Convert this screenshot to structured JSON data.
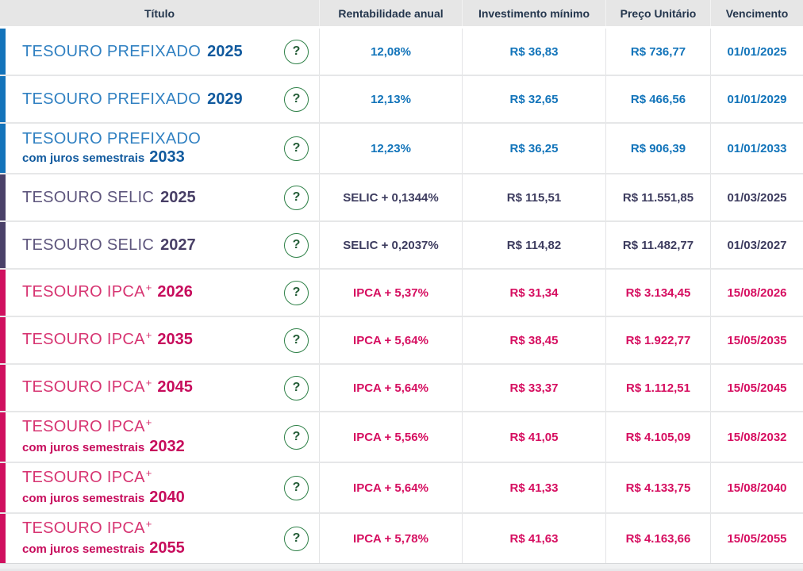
{
  "table": {
    "columns": [
      {
        "key": "titulo",
        "label": "Título"
      },
      {
        "key": "rentabilidade",
        "label": "Rentabilidade anual"
      },
      {
        "key": "investimento",
        "label": "Investimento mínimo"
      },
      {
        "key": "preco",
        "label": "Preço Unitário"
      },
      {
        "key": "vencimento",
        "label": "Vencimento"
      }
    ],
    "help_icon": "?",
    "help_icon_border_color": "#2f8148",
    "families": {
      "prefixado": {
        "bar": "#1373ba",
        "name_color": "#3181c2",
        "strong_color": "#115a9e",
        "value_color": "#1274ba"
      },
      "selic": {
        "bar": "#4a4169",
        "name_color": "#5e567d",
        "strong_color": "#483f66",
        "value_color": "#3d3c5f"
      },
      "ipca": {
        "bar": "#d0105f",
        "name_color": "#d73572",
        "strong_color": "#c70c5c",
        "value_color": "#d60e60"
      }
    },
    "rows": [
      {
        "family": "prefixado",
        "name": "TESOURO PREFIXADO",
        "sup": "",
        "sub": "",
        "year": "2025",
        "rentabilidade": "12,08%",
        "investimento": "R$ 36,83",
        "preco": "R$ 736,77",
        "vencimento": "01/01/2025"
      },
      {
        "family": "prefixado",
        "name": "TESOURO PREFIXADO",
        "sup": "",
        "sub": "",
        "year": "2029",
        "rentabilidade": "12,13%",
        "investimento": "R$ 32,65",
        "preco": "R$ 466,56",
        "vencimento": "01/01/2029"
      },
      {
        "family": "prefixado",
        "name": "TESOURO PREFIXADO",
        "sup": "",
        "sub": "com juros semestrais",
        "year": "2033",
        "rentabilidade": "12,23%",
        "investimento": "R$ 36,25",
        "preco": "R$ 906,39",
        "vencimento": "01/01/2033"
      },
      {
        "family": "selic",
        "name": "TESOURO SELIC",
        "sup": "",
        "sub": "",
        "year": "2025",
        "rentabilidade": "SELIC + 0,1344%",
        "investimento": "R$ 115,51",
        "preco": "R$ 11.551,85",
        "vencimento": "01/03/2025"
      },
      {
        "family": "selic",
        "name": "TESOURO SELIC",
        "sup": "",
        "sub": "",
        "year": "2027",
        "rentabilidade": "SELIC + 0,2037%",
        "investimento": "R$ 114,82",
        "preco": "R$ 11.482,77",
        "vencimento": "01/03/2027"
      },
      {
        "family": "ipca",
        "name": "TESOURO IPCA",
        "sup": "+",
        "sub": "",
        "year": "2026",
        "rentabilidade": "IPCA + 5,37%",
        "investimento": "R$ 31,34",
        "preco": "R$ 3.134,45",
        "vencimento": "15/08/2026"
      },
      {
        "family": "ipca",
        "name": "TESOURO IPCA",
        "sup": "+",
        "sub": "",
        "year": "2035",
        "rentabilidade": "IPCA + 5,64%",
        "investimento": "R$ 38,45",
        "preco": "R$ 1.922,77",
        "vencimento": "15/05/2035"
      },
      {
        "family": "ipca",
        "name": "TESOURO IPCA",
        "sup": "+",
        "sub": "",
        "year": "2045",
        "rentabilidade": "IPCA + 5,64%",
        "investimento": "R$ 33,37",
        "preco": "R$ 1.112,51",
        "vencimento": "15/05/2045"
      },
      {
        "family": "ipca",
        "name": "TESOURO IPCA",
        "sup": "+",
        "sub": "com juros semestrais",
        "year": "2032",
        "rentabilidade": "IPCA + 5,56%",
        "investimento": "R$ 41,05",
        "preco": "R$ 4.105,09",
        "vencimento": "15/08/2032"
      },
      {
        "family": "ipca",
        "name": "TESOURO IPCA",
        "sup": "+",
        "sub": "com juros semestrais",
        "year": "2040",
        "rentabilidade": "IPCA + 5,64%",
        "investimento": "R$ 41,33",
        "preco": "R$ 4.133,75",
        "vencimento": "15/08/2040"
      },
      {
        "family": "ipca",
        "name": "TESOURO IPCA",
        "sup": "+",
        "sub": "com juros semestrais",
        "year": "2055",
        "rentabilidade": "IPCA + 5,78%",
        "investimento": "R$ 41,63",
        "preco": "R$ 4.163,66",
        "vencimento": "15/05/2055"
      }
    ]
  }
}
